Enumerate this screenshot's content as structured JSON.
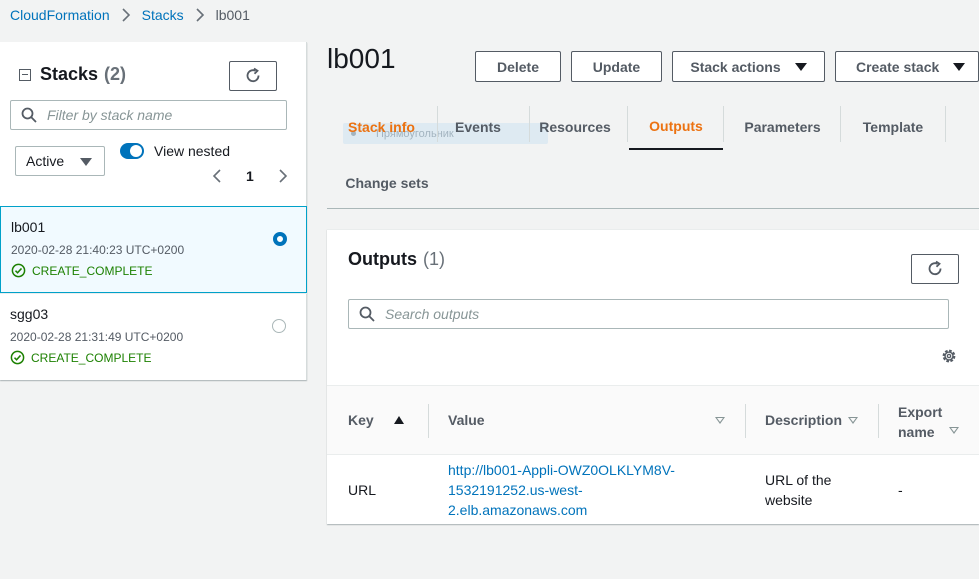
{
  "breadcrumb": {
    "items": [
      "CloudFormation",
      "Stacks"
    ],
    "current": "lb001"
  },
  "left": {
    "title": "Stacks",
    "count": "(2)",
    "filter_placeholder": "Filter by stack name",
    "status_filter": "Active",
    "view_nested_label": "View nested",
    "page": "1",
    "stacks": [
      {
        "name": "lb001",
        "time": "2020-02-28 21:40:23 UTC+0200",
        "status": "CREATE_COMPLETE",
        "selected": true
      },
      {
        "name": "sgg03",
        "time": "2020-02-28 21:31:49 UTC+0200",
        "status": "CREATE_COMPLETE",
        "selected": false
      }
    ]
  },
  "main": {
    "title": "lb001",
    "buttons": {
      "delete": "Delete",
      "update": "Update",
      "stack_actions": "Stack actions",
      "create_stack": "Create stack"
    },
    "tabs": [
      "Stack info",
      "Events",
      "Resources",
      "Outputs",
      "Parameters",
      "Template",
      "Change sets"
    ],
    "ghost_text": "Прямоугольник"
  },
  "outputs": {
    "title": "Outputs",
    "count": "(1)",
    "search_placeholder": "Search outputs",
    "columns": [
      "Key",
      "Value",
      "Description",
      "Export name"
    ],
    "rows": [
      {
        "key": "URL",
        "value": [
          "http://lb001-Appli-OWZ0OLKLYM8V-",
          "1532191252.us-west-",
          "2.elb.amazonaws.com"
        ],
        "description": [
          "URL of the",
          "website"
        ],
        "export": "-"
      }
    ]
  },
  "colors": {
    "accent": "#ec7211",
    "link": "#0073bb",
    "success": "#1d8102"
  }
}
